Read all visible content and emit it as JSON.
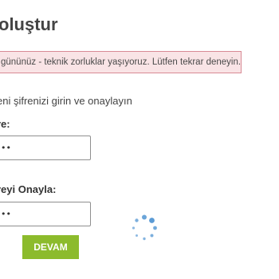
{
  "page": {
    "title": "oluştur"
  },
  "alert": {
    "message": "gününüz - teknik zorluklar yaşıyoruz. Lütfen tekrar deneyin."
  },
  "form": {
    "instruction": "eni şifrenizi girin ve onaylayın",
    "new_password": {
      "label": "re:",
      "value": "••"
    },
    "confirm_password": {
      "label": "reyi Onayla:",
      "value": "••"
    },
    "submit_label": "DEVAM"
  },
  "colors": {
    "alert_background": "#f9e4e6",
    "alert_border": "#d88a95",
    "button_background": "#8cbb2c",
    "spinner": "#5b9bd5"
  },
  "icons": {
    "loading": "spinner-icon"
  }
}
